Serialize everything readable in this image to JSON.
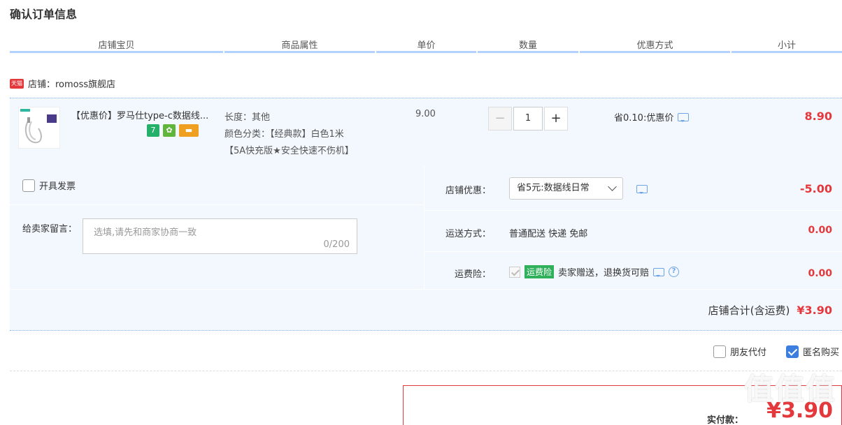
{
  "page": {
    "title": "确认订单信息"
  },
  "columns": [
    "店铺宝贝",
    "商品属性",
    "单价",
    "数量",
    "优惠方式",
    "小计"
  ],
  "shop": {
    "badge": "天猫",
    "name": "店铺：romoss旗舰店"
  },
  "item": {
    "title": "【优惠价】罗马仕type-c数据线...",
    "badges": [
      "7",
      "✿",
      "▬"
    ],
    "attr_length": "长度：其他",
    "attr_color": "颜色分类：【经典款】白色1米",
    "attr_color2": "【5A快充版★安全快速不伤机】",
    "unit_price": "9.00",
    "qty_minus": "−",
    "qty": "1",
    "qty_plus": "+",
    "discount": "省0.10:优惠价",
    "subtotal": "8.90"
  },
  "invoice": {
    "label": "开具发票"
  },
  "note": {
    "label": "给卖家留言：",
    "placeholder": "选填,请先和商家协商一致",
    "count": "0/200"
  },
  "shop_discount": {
    "label": "店铺优惠：",
    "selected": "省5元:数据线日常",
    "amount": "-5.00"
  },
  "shipping": {
    "label": "运送方式：",
    "value": "普通配送 快递 免邮",
    "amount": "0.00"
  },
  "insurance": {
    "label": "运费险：",
    "tag": "运费险",
    "text": "卖家赠送，退换货可赔",
    "amount": "0.00"
  },
  "shop_total": {
    "label": "店铺合计(含运费)",
    "amount": "¥3.90"
  },
  "options": {
    "friend_pay": "朋友代付",
    "anonymous": "匿名购买"
  },
  "payment": {
    "label": "实付款：",
    "amount": "¥3.90"
  },
  "watermark": "值值值",
  "colors": {
    "accent": "#3b7ee0",
    "price": "#e4393c",
    "panel": "#f3f8fe"
  }
}
